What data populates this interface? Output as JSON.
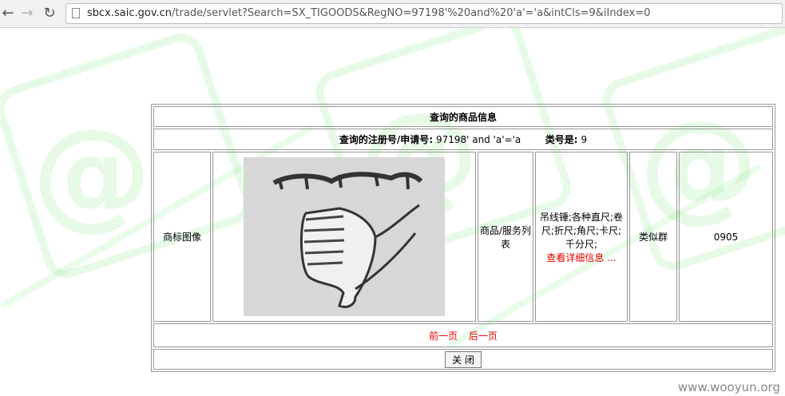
{
  "browser": {
    "url_host": "sbcx.saic.gov.cn",
    "url_path": "/trade/servlet?Search=SX_TIGOODS&RegNO=97198'%20and%20'a'='a&intCls=9&iIndex=0"
  },
  "panel": {
    "title": "查询的商品信息",
    "reg_label": "查询的注册号/申请号:",
    "reg_value": "97198' and 'a'='a",
    "class_label": "类号是:",
    "class_value": "9",
    "image_label": "商标图像",
    "goods_label": "商品/服务列表",
    "goods_text": "吊线锤;各种直尺;卷尺;折尺;角尺;卡尺;千分尺;",
    "details_link": "查看详细信息 ...",
    "similar_label": "类似群",
    "similar_value": "0905",
    "prev_page": "前一页",
    "next_page": "后一页",
    "close_button": "关 闭"
  },
  "footer": {
    "watermark_text": "www.wooyun.org"
  }
}
